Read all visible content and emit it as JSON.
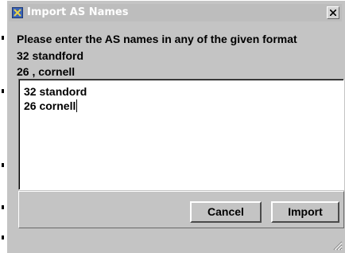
{
  "dialog": {
    "title": "Import AS Names",
    "instruction": "Please enter the AS names in any of the given format",
    "format_examples": [
      "32 standford",
      "26 , cornell"
    ],
    "input": {
      "lines": [
        "32 standord",
        "26 cornell"
      ]
    },
    "buttons": {
      "cancel_label": "Cancel",
      "import_label": "Import"
    },
    "icons": {
      "app": "app-icon",
      "close": "close-icon",
      "resize": "resize-grip-icon"
    }
  },
  "colors": {
    "dialog_bg": "#c4c4c4",
    "titlebar_bg": "#bdbdbd",
    "title_text": "#ffffff",
    "input_bg": "#ffffff"
  }
}
